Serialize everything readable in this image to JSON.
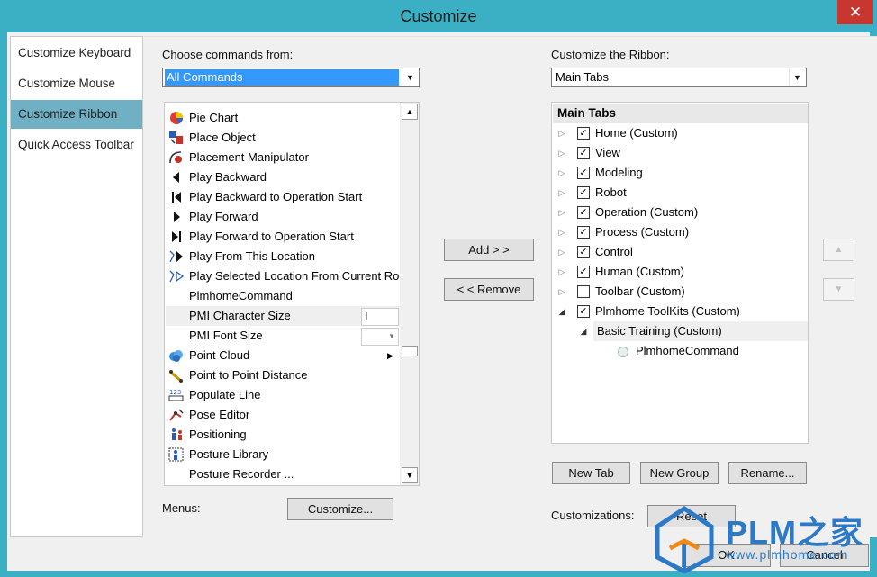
{
  "window": {
    "title": "Customize",
    "close_glyph": "✕"
  },
  "nav": {
    "items": [
      {
        "label": "Customize Keyboard",
        "selected": false
      },
      {
        "label": "Customize Mouse",
        "selected": false
      },
      {
        "label": "Customize Ribbon",
        "selected": true
      },
      {
        "label": "Quick Access Toolbar",
        "selected": false
      }
    ]
  },
  "left": {
    "choose_label": "Choose commands from:",
    "choose_value": "All Commands",
    "commands": [
      {
        "label": "Pie Chart",
        "icon": "pie-chart-icon"
      },
      {
        "label": "Place Object",
        "icon": "place-object-icon"
      },
      {
        "label": "Placement Manipulator",
        "icon": "placement-manipulator-icon"
      },
      {
        "label": "Play Backward",
        "icon": "play-backward-icon"
      },
      {
        "label": "Play Backward to Operation Start",
        "icon": "play-backward-start-icon"
      },
      {
        "label": "Play Forward",
        "icon": "play-forward-icon"
      },
      {
        "label": "Play Forward to Operation Start",
        "icon": "play-forward-start-icon"
      },
      {
        "label": "Play From This Location",
        "icon": "play-from-location-icon"
      },
      {
        "label": "Play Selected Location From Current Ro",
        "icon": "play-selected-location-icon"
      },
      {
        "label": "PlmhomeCommand",
        "icon": ""
      },
      {
        "label": "PMI Character Size",
        "icon": ""
      },
      {
        "label": "PMI Font Size",
        "icon": ""
      },
      {
        "label": "Point Cloud",
        "icon": "point-cloud-icon"
      },
      {
        "label": "Point to Point Distance",
        "icon": "point-distance-icon"
      },
      {
        "label": "Populate Line",
        "icon": "populate-line-icon"
      },
      {
        "label": "Pose Editor",
        "icon": "pose-editor-icon"
      },
      {
        "label": "Positioning",
        "icon": "positioning-icon"
      },
      {
        "label": "Posture Library",
        "icon": "posture-library-icon"
      },
      {
        "label": "Posture Recorder ...",
        "icon": ""
      }
    ],
    "menus_label": "Menus:",
    "customize_button": "Customize..."
  },
  "middle": {
    "add_button": "Add > >",
    "remove_button": "< < Remove"
  },
  "right": {
    "ribbon_label": "Customize the Ribbon:",
    "ribbon_value": "Main Tabs",
    "tree_header": "Main Tabs",
    "tabs": [
      {
        "label": "Home (Custom)",
        "checked": true,
        "expanded": false
      },
      {
        "label": "View",
        "checked": true,
        "expanded": false
      },
      {
        "label": "Modeling",
        "checked": true,
        "expanded": false
      },
      {
        "label": "Robot",
        "checked": true,
        "expanded": false
      },
      {
        "label": "Operation (Custom)",
        "checked": true,
        "expanded": false
      },
      {
        "label": "Process (Custom)",
        "checked": true,
        "expanded": false
      },
      {
        "label": "Control",
        "checked": true,
        "expanded": false
      },
      {
        "label": "Human (Custom)",
        "checked": true,
        "expanded": false
      },
      {
        "label": "Toolbar (Custom)",
        "checked": false,
        "expanded": false
      },
      {
        "label": "Plmhome ToolKits (Custom)",
        "checked": true,
        "expanded": true
      }
    ],
    "group": {
      "label": "Basic Training (Custom)"
    },
    "group_item": {
      "label": "PlmhomeCommand"
    },
    "new_tab_button": "New Tab",
    "new_group_button": "New Group",
    "rename_button": "Rename...",
    "customizations_label": "Customizations:",
    "reset_button": "Reset"
  },
  "footer": {
    "ok_button": "OK",
    "cancel_button": "Cancel"
  },
  "watermark": {
    "brand": "PLM之家",
    "url": "www.plmhome.com"
  }
}
